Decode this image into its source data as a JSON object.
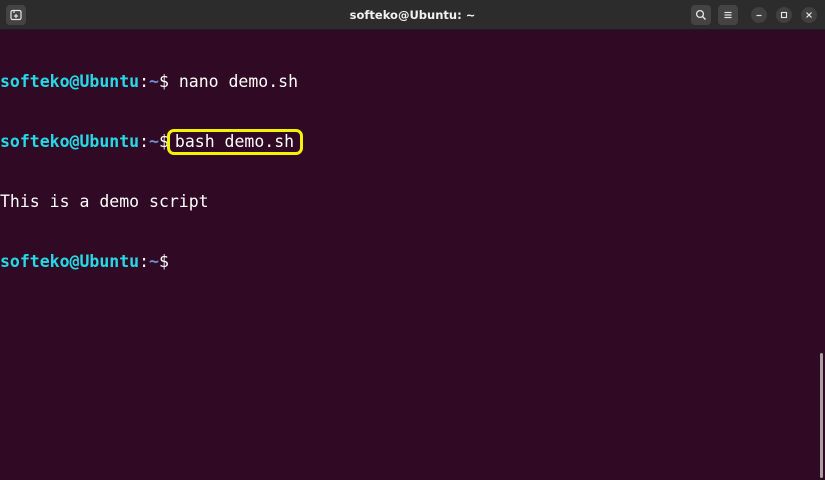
{
  "window": {
    "title": "softeko@Ubuntu: ~"
  },
  "terminal": {
    "lines": [
      {
        "user": "softeko@Ubuntu",
        "sep": ":",
        "path": "~",
        "prompt": "$",
        "command": " nano demo.sh"
      },
      {
        "user": "softeko@Ubuntu",
        "sep": ":",
        "path": "~",
        "prompt": "$",
        "command": "bash demo.sh"
      },
      {
        "output": "This is a demo script"
      },
      {
        "user": "softeko@Ubuntu",
        "sep": ":",
        "path": "~",
        "prompt": "$"
      }
    ]
  },
  "colors": {
    "background": "#300a24",
    "titlebar": "#2c2c2c",
    "user": "#26d9e6",
    "path": "#6b8fd6",
    "highlight": "#f4f400"
  },
  "icons": {
    "new_tab": "new-tab-icon",
    "search": "search-icon",
    "menu": "hamburger-menu-icon",
    "minimize": "minimize-icon",
    "maximize": "maximize-icon",
    "close": "close-icon"
  }
}
